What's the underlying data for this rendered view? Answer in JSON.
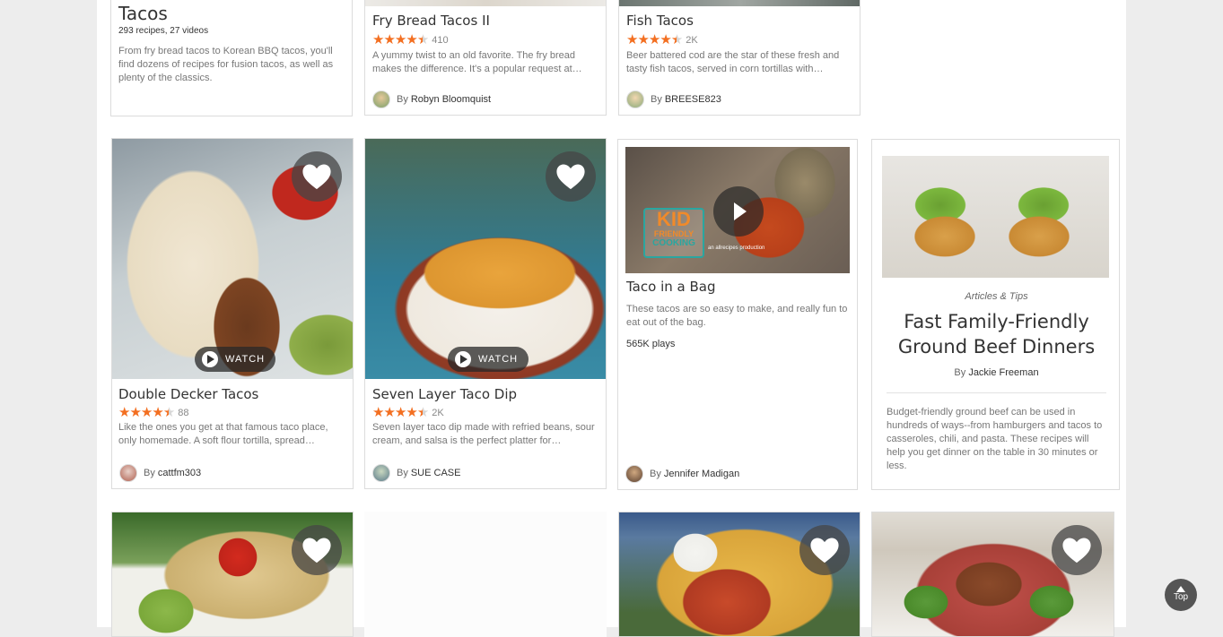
{
  "top_row": {
    "category": {
      "title": "Tacos",
      "meta": "293 recipes, 27 videos",
      "description": "From fry bread tacos to Korean BBQ tacos, you'll find dozens of recipes for fusion tacos, as well as plenty of the classics."
    },
    "fry_bread": {
      "title": "Fry Bread Tacos II",
      "rating_count": "410",
      "description": "A yummy twist to an old favorite. The fry bread makes the difference. It's a popular request at…",
      "by": "By",
      "author": "Robyn Bloomquist"
    },
    "fish": {
      "title": "Fish Tacos",
      "rating_count": "2K",
      "description": "Beer battered cod are the star of these fresh and tasty fish tacos, served in corn tortillas with…",
      "by": "By",
      "author": "BREESE823"
    }
  },
  "middle_row": {
    "double_decker": {
      "title": "Double Decker Tacos",
      "rating_count": "88",
      "description": "Like the ones you get at that famous taco place, only homemade. A soft flour tortilla, spread…",
      "by": "By",
      "author": "cattfm303",
      "watch": "WATCH"
    },
    "seven_layer": {
      "title": "Seven Layer Taco Dip",
      "rating_count": "2K",
      "description": "Seven layer taco dip made with refried beans, sour cream, and salsa is the perfect platter for…",
      "by": "By",
      "author": "SUE CASE",
      "watch": "WATCH"
    },
    "taco_bag": {
      "title": "Taco in a Bag",
      "description": "These tacos are so easy to make, and really fun to eat out of the bag.",
      "plays": "565K plays",
      "by": "By",
      "author": "Jennifer Madigan",
      "logo_kid": "KID",
      "logo_friendly": "FRIENDLY",
      "logo_cooking": "COOKING",
      "logo_sub": "an allrecipes production"
    },
    "article": {
      "tag": "Articles & Tips",
      "title": "Fast Family-Friendly Ground Beef Dinners",
      "by": "By",
      "author": "Jackie Freeman",
      "description": "Budget-friendly ground beef can be used in hundreds of ways--from hamburgers and tacos to casseroles, chili, and pasta. These recipes will help you get dinner on the table in 30 minutes or less."
    }
  },
  "top_button": "Top",
  "colors": {
    "star": "#f36f21",
    "background": "#ededed"
  }
}
